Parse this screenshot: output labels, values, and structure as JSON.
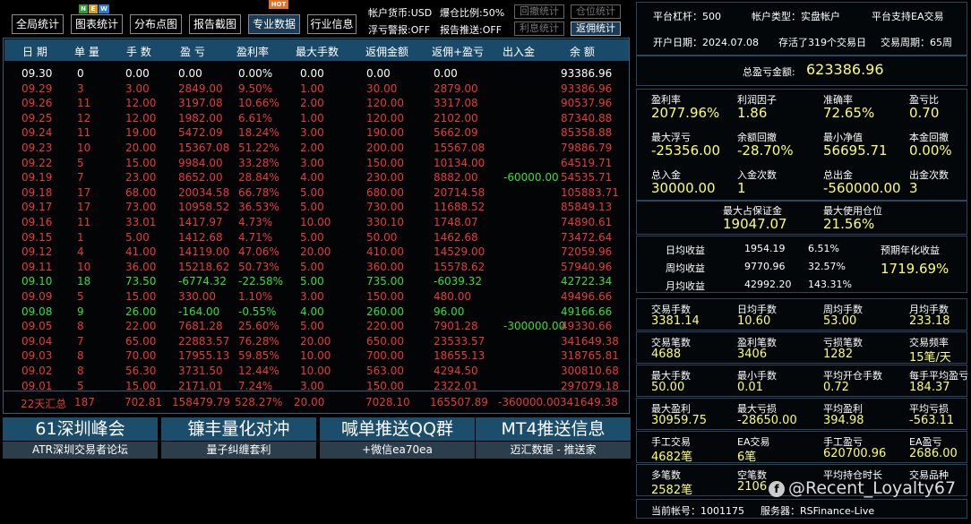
{
  "toolbar": {
    "buttons": [
      "全局统计",
      "图表统计",
      "分布点图",
      "报告截图",
      "专业数据",
      "行业信息"
    ],
    "badges": {
      "n": "N",
      "e": "E",
      "w": "W",
      "hot": "HOT"
    }
  },
  "account_info": {
    "currency": "帐户货币:USD",
    "exposure": "爆仓比例:50%",
    "float_alert": "浮亏警报:OFF",
    "report_push": "报告推送:OFF",
    "btn_drawdown": "回撤统计",
    "btn_position": "仓位统计",
    "btn_interest": "利息统计",
    "btn_rebate": "返佣统计"
  },
  "table": {
    "headers": [
      "日 期",
      "单 量",
      "手 数",
      "盈 亏",
      "盈利率",
      "最大手数",
      "返佣金额",
      "返佣+盈亏",
      "出入金",
      "余 额"
    ],
    "rows": [
      {
        "c": "w",
        "v": [
          "09.30",
          "0",
          "0.00",
          "0.00",
          "0.00%",
          "0.00",
          "0.00",
          "0.00",
          "",
          "93386.96"
        ]
      },
      {
        "c": "r",
        "v": [
          "09.29",
          "3",
          "3.00",
          "2849.00",
          "9.50%",
          "1.00",
          "30.00",
          "2879.00",
          "",
          "93386.96"
        ]
      },
      {
        "c": "r",
        "v": [
          "09.26",
          "11",
          "12.00",
          "3197.08",
          "10.66%",
          "2.00",
          "120.00",
          "3317.08",
          "",
          "90537.96"
        ]
      },
      {
        "c": "r",
        "v": [
          "09.25",
          "12",
          "12.00",
          "1982.00",
          "6.61%",
          "1.00",
          "120.00",
          "2102.00",
          "",
          "87340.88"
        ]
      },
      {
        "c": "r",
        "v": [
          "09.24",
          "11",
          "19.00",
          "5472.09",
          "18.24%",
          "3.00",
          "190.00",
          "5662.09",
          "",
          "85358.88"
        ]
      },
      {
        "c": "r",
        "v": [
          "09.23",
          "10",
          "20.00",
          "15367.08",
          "51.22%",
          "2.00",
          "200.00",
          "15567.08",
          "",
          "79886.79"
        ]
      },
      {
        "c": "r",
        "v": [
          "09.22",
          "5",
          "15.00",
          "9984.00",
          "33.28%",
          "3.00",
          "150.00",
          "10134.00",
          "",
          "64519.71"
        ]
      },
      {
        "c": "r",
        "v": [
          "09.19",
          "7",
          "23.00",
          "8652.00",
          "28.84%",
          "4.00",
          "230.00",
          "8882.00",
          "-60000.00",
          "54535.71"
        ]
      },
      {
        "c": "r",
        "v": [
          "09.18",
          "17",
          "68.00",
          "20034.58",
          "66.78%",
          "5.00",
          "680.00",
          "20714.58",
          "",
          "105883.71"
        ]
      },
      {
        "c": "r",
        "v": [
          "09.17",
          "17",
          "73.00",
          "10958.52",
          "36.53%",
          "5.00",
          "730.00",
          "11688.52",
          "",
          "85849.13"
        ]
      },
      {
        "c": "r",
        "v": [
          "09.16",
          "11",
          "33.01",
          "1417.97",
          "4.73%",
          "10.00",
          "330.10",
          "1748.07",
          "",
          "74890.61"
        ]
      },
      {
        "c": "r",
        "v": [
          "09.15",
          "1",
          "5.00",
          "1412.68",
          "4.71%",
          "5.00",
          "50.00",
          "1462.68",
          "",
          "73472.64"
        ]
      },
      {
        "c": "r",
        "v": [
          "09.12",
          "4",
          "41.00",
          "14119.00",
          "47.06%",
          "20.00",
          "410.00",
          "14529.00",
          "",
          "72059.96"
        ]
      },
      {
        "c": "r",
        "v": [
          "09.11",
          "10",
          "36.00",
          "15218.62",
          "50.73%",
          "5.00",
          "360.00",
          "15578.62",
          "",
          "57940.96"
        ]
      },
      {
        "c": "g",
        "v": [
          "09.10",
          "18",
          "73.50",
          "-6774.32",
          "-22.58%",
          "5.00",
          "735.00",
          "-6039.32",
          "",
          "42722.34"
        ]
      },
      {
        "c": "r",
        "v": [
          "09.09",
          "5",
          "15.00",
          "330.00",
          "1.10%",
          "3.00",
          "150.00",
          "480.00",
          "",
          "49496.66"
        ]
      },
      {
        "c": "g",
        "v": [
          "09.08",
          "9",
          "26.00",
          "-164.00",
          "-0.55%",
          "4.00",
          "260.00",
          "96.00",
          "",
          "49166.66"
        ]
      },
      {
        "c": "r",
        "v": [
          "09.05",
          "8",
          "22.00",
          "7681.28",
          "25.60%",
          "5.00",
          "220.00",
          "7901.28",
          "-300000.00",
          "49330.66"
        ]
      },
      {
        "c": "r",
        "v": [
          "09.04",
          "7",
          "65.00",
          "22883.57",
          "76.28%",
          "20.00",
          "650.00",
          "23533.57",
          "",
          "341649.38"
        ]
      },
      {
        "c": "r",
        "v": [
          "09.03",
          "8",
          "70.00",
          "17955.13",
          "59.85%",
          "10.00",
          "700.00",
          "18655.13",
          "",
          "318765.81"
        ]
      },
      {
        "c": "r",
        "v": [
          "09.02",
          "8",
          "56.30",
          "3731.50",
          "12.44%",
          "10.00",
          "563.00",
          "4294.50",
          "",
          "300810.68"
        ]
      },
      {
        "c": "r",
        "v": [
          "09.01",
          "5",
          "15.00",
          "2171.01",
          "7.24%",
          "3.00",
          "150.00",
          "2322.01",
          "",
          "297079.18"
        ]
      }
    ],
    "summary": [
      "22天汇总",
      "187",
      "702.81",
      "158479.79",
      "528.27%",
      "20.00",
      "7028.10",
      "165507.89",
      "-360000.00",
      "341649.38"
    ]
  },
  "banners": [
    {
      "title": "61深圳峰会",
      "sub": "ATR深圳交易者论坛"
    },
    {
      "title": "镰丰量化对冲",
      "sub": "量子纠缠套利"
    },
    {
      "title": "喊单推送QQ群",
      "sub": "+微信ea70ea"
    },
    {
      "title": "MT4推送信息",
      "sub": "迈汇数据 - 推送家"
    }
  ],
  "stats": {
    "leverage": "平台杠杆：500",
    "account_type": "帐户类型：实盘帐户",
    "ea_support": "平台支持EA交易",
    "open_date": "开户日期：2024.07.08",
    "alive": "存活了319个交易日",
    "cycle": "交易周期：65周",
    "total_pl_label": "总盈亏金额:",
    "total_pl_value": "623386.96",
    "g1": [
      {
        "l": "盈利率",
        "v": "2077.96%"
      },
      {
        "l": "利润因子",
        "v": "1.86"
      },
      {
        "l": "准确率",
        "v": "72.65%"
      },
      {
        "l": "盈亏比",
        "v": "0.70"
      },
      {
        "l": "最大浮亏",
        "v": "-25356.00"
      },
      {
        "l": "余额回撤",
        "v": "-28.70%"
      },
      {
        "l": "最小净值",
        "v": "56695.71"
      },
      {
        "l": "本金回撤",
        "v": "0.00%"
      },
      {
        "l": "总入金",
        "v": "30000.00"
      },
      {
        "l": "入金次数",
        "v": "1"
      },
      {
        "l": "总出金",
        "v": "-560000.00"
      },
      {
        "l": "出金次数",
        "v": "3"
      }
    ],
    "margin_label": "最大占保证金",
    "margin_value": "19047.07",
    "maxpos_label": "最大使用仓位",
    "maxpos_value": "21.56%",
    "daily": {
      "l": "日均收益",
      "a": "1954.19",
      "p": "6.51%"
    },
    "weekly": {
      "l": "周均收益",
      "a": "9770.96",
      "p": "32.57%"
    },
    "monthly": {
      "l": "月均收益",
      "a": "42992.20",
      "p": "143.31%"
    },
    "annual_label": "预期年化收益",
    "annual_value": "1719.69%",
    "g2": [
      {
        "l": "交易手数",
        "v": "3381.14"
      },
      {
        "l": "日均手数",
        "v": "10.60"
      },
      {
        "l": "周均手数",
        "v": "53.00"
      },
      {
        "l": "月均手数",
        "v": "233.18"
      },
      {
        "l": "交易笔数",
        "v": "4688"
      },
      {
        "l": "盈利笔数",
        "v": "3406"
      },
      {
        "l": "亏损笔数",
        "v": "1282"
      },
      {
        "l": "交易频率",
        "v": "15笔/天"
      },
      {
        "l": "最大手数",
        "v": "50.00"
      },
      {
        "l": "最小手数",
        "v": "0.01"
      },
      {
        "l": "平均开仓手数",
        "v": "0.72"
      },
      {
        "l": "每手平均盈亏",
        "v": "184.37"
      },
      {
        "l": "最大盈利",
        "v": "30959.75"
      },
      {
        "l": "最大亏损",
        "v": "-28650.00"
      },
      {
        "l": "平均盈利",
        "v": "394.98"
      },
      {
        "l": "平均亏损",
        "v": "-563.11"
      },
      {
        "l": "手工交易",
        "v": "4682笔"
      },
      {
        "l": "EA交易",
        "v": "6笔"
      },
      {
        "l": "手工盈亏",
        "v": "620700.96"
      },
      {
        "l": "EA盈亏",
        "v": "2686.00"
      },
      {
        "l": "多笔数",
        "v": "2582笔"
      },
      {
        "l": "空笔数",
        "v": "2106"
      },
      {
        "l": "平均持仓时长",
        "v": ""
      },
      {
        "l": "交易品种",
        "v": ""
      }
    ],
    "account_no": "当前帐号：1001175",
    "server": "服务器：RSFinance-Live"
  },
  "watermark": {
    "icon": "f",
    "text": "@Recent_Loyalty67"
  }
}
